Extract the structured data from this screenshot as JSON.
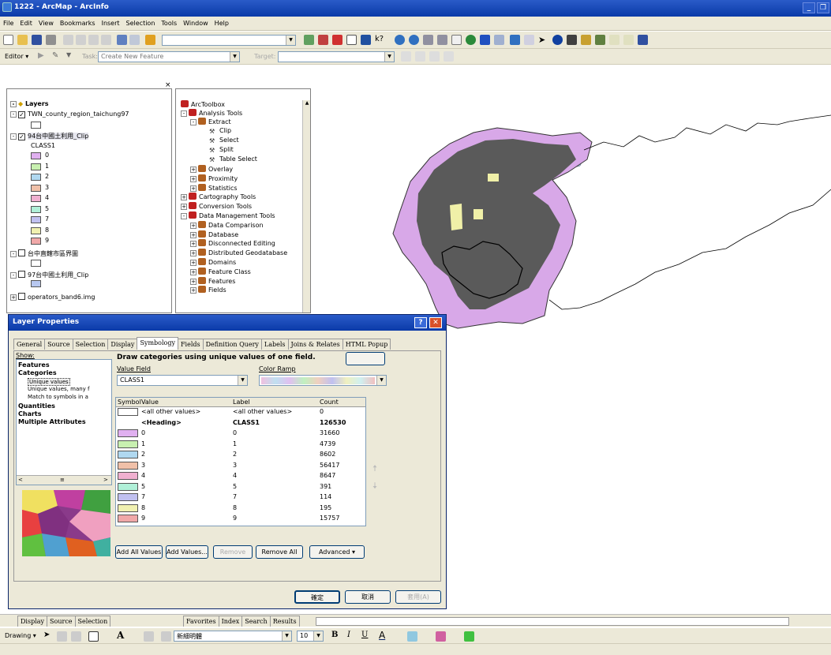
{
  "app": {
    "title": "1222 - ArcMap - ArcInfo"
  },
  "menu": [
    "File",
    "Edit",
    "View",
    "Bookmarks",
    "Insert",
    "Selection",
    "Tools",
    "Window",
    "Help"
  ],
  "editor": {
    "label": "Editor ▾",
    "task": "Create New Feature",
    "target": "Target:"
  },
  "toc": {
    "root": "Layers",
    "layers": [
      {
        "name": "TWN_county_region_taichung97",
        "checked": true
      },
      {
        "name": "94台中國土利用_Clip",
        "checked": true,
        "field": "CLASS1",
        "classes": [
          "0",
          "1",
          "2",
          "3",
          "4",
          "5",
          "7",
          "8",
          "9"
        ]
      },
      {
        "name": "台中直轄市區界圖",
        "checked": false
      },
      {
        "name": "97台中國土利用_Clip",
        "checked": false
      },
      {
        "name": "operators_band6.img",
        "checked": false
      }
    ]
  },
  "toolbox": {
    "root": "ArcToolbox",
    "items": [
      "Analysis Tools",
      "Extract",
      "Clip",
      "Select",
      "Split",
      "Table Select",
      "Overlay",
      "Proximity",
      "Statistics",
      "Cartography Tools",
      "Conversion Tools",
      "Data Management Tools",
      "Data Comparison",
      "Database",
      "Disconnected Editing",
      "Distributed Geodatabase",
      "Domains",
      "Feature Class",
      "Features",
      "Fields"
    ]
  },
  "dialog": {
    "title": "Layer Properties",
    "tabs": [
      "General",
      "Source",
      "Selection",
      "Display",
      "Symbology",
      "Fields",
      "Definition Query",
      "Labels",
      "Joins & Relates",
      "HTML Popup"
    ],
    "show_label": "Show:",
    "show_items": [
      "Features",
      "Categories",
      "Unique values",
      "Unique values, many f",
      "Match to symbols in a",
      "Quantities",
      "Charts",
      "Multiple Attributes"
    ],
    "heading": "Draw categories using unique values of one field.",
    "import": "Import...",
    "value_field_label": "Value Field",
    "value_field": "CLASS1",
    "color_ramp_label": "Color Ramp",
    "columns": [
      "Symbol",
      "Value",
      "Label",
      "Count"
    ],
    "rows": [
      {
        "value": "<all other values>",
        "label": "<all other values>",
        "count": "0",
        "color": "#ffffff"
      },
      {
        "value": "<Heading>",
        "label": "CLASS1",
        "count": "126530",
        "color": ""
      },
      {
        "value": "0",
        "label": "0",
        "count": "31660",
        "color": "#e0b0f0"
      },
      {
        "value": "1",
        "label": "1",
        "count": "4739",
        "color": "#c8f0b0"
      },
      {
        "value": "2",
        "label": "2",
        "count": "8602",
        "color": "#b0d8f0"
      },
      {
        "value": "3",
        "label": "3",
        "count": "56417",
        "color": "#f0c0a8"
      },
      {
        "value": "4",
        "label": "4",
        "count": "8647",
        "color": "#f0b0d0"
      },
      {
        "value": "5",
        "label": "5",
        "count": "391",
        "color": "#b0f0d8"
      },
      {
        "value": "7",
        "label": "7",
        "count": "114",
        "color": "#c0c0f0"
      },
      {
        "value": "8",
        "label": "8",
        "count": "195",
        "color": "#f0f0b0"
      },
      {
        "value": "9",
        "label": "9",
        "count": "15757",
        "color": "#f0a8a8"
      }
    ],
    "buttons": {
      "add_all": "Add All Values",
      "add": "Add Values...",
      "remove": "Remove",
      "remove_all": "Remove All",
      "advanced": "Advanced ▾",
      "ok": "確定",
      "cancel": "取消",
      "apply": "套用(A)"
    }
  },
  "bottom": {
    "tabs_left": [
      "Display",
      "Source",
      "Selection"
    ],
    "tabs_right": [
      "Favorites",
      "Index",
      "Search",
      "Results"
    ],
    "drawing": "Drawing ▾",
    "font": "新細明體",
    "size": "10"
  },
  "colors": {
    "map_fill": "#5a5a5a",
    "landuse": "#d8a8e8",
    "river": "#a8d4ec",
    "yellow": "#f0f0a8"
  }
}
